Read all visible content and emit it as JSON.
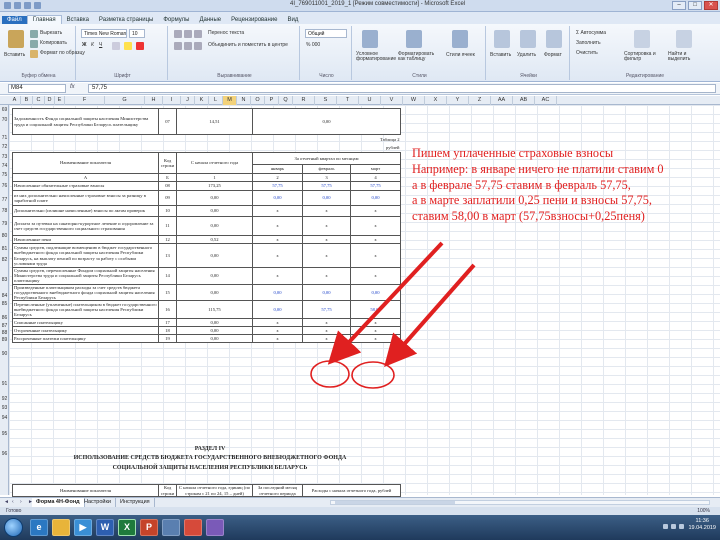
{
  "window": {
    "title": "4I_769011001_2019_1  [Режим совместимости] - Microsoft Excel",
    "minimize": "–",
    "restore": "□",
    "close": "✕"
  },
  "ribbon_tabs": [
    "Файл",
    "Главная",
    "Вставка",
    "Разметка страницы",
    "Формулы",
    "Данные",
    "Рецензирование",
    "Вид"
  ],
  "ribbon": {
    "clipboard": {
      "paste": "Вставить",
      "cut": "Вырезать",
      "copy": "Копировать",
      "format_painter": "Формат по образцу",
      "label": "Буфер обмена"
    },
    "font": {
      "name": "Times New Roman",
      "size": "10",
      "label": "Шрифт"
    },
    "alignment": {
      "wrap": "Перенос текста",
      "merge": "Объединить и поместить в центре",
      "label": "Выравнивание"
    },
    "number": {
      "format": "Общий",
      "label": "Число"
    },
    "styles": {
      "conditional": "Условное форматирование",
      "table": "Форматировать как таблицу",
      "cell_styles": "Стили ячеек",
      "label": "Стили"
    },
    "cells": {
      "insert": "Вставить",
      "delete": "Удалить",
      "format": "Формат",
      "label": "Ячейки"
    },
    "editing": {
      "autosum": "Автосумма",
      "fill": "Заполнить",
      "clear": "Очистить",
      "sort": "Сортировка и фильтр",
      "find": "Найти и выделить",
      "label": "Редактирование"
    }
  },
  "formula_bar": {
    "name_box": "M84",
    "fx": "fx",
    "value": "57,75"
  },
  "columns": [
    "A",
    "B",
    "C",
    "D",
    "E",
    "F",
    "G",
    "H",
    "I",
    "J",
    "K",
    "L",
    "M",
    "N",
    "O",
    "P",
    "Q",
    "R",
    "S",
    "T",
    "U",
    "V",
    "W",
    "X",
    "Y",
    "Z",
    "AA",
    "AB",
    "AC"
  ],
  "rows": [
    "69",
    "70",
    "71",
    "72",
    "73",
    "74",
    "75",
    "76",
    "77",
    "78",
    "79",
    "80",
    "81",
    "82",
    "83",
    "84",
    "85",
    "86",
    "87",
    "88",
    "89",
    "90",
    "91",
    "92",
    "93",
    "94",
    "95",
    "96"
  ],
  "sheet": {
    "row70": {
      "name": "Задолженность Фонда социальной защиты населения Министерства труда и социальной защиты Республики Беларусь плательщику",
      "code": "07",
      "start": "14,51",
      "q": "0,00"
    },
    "table2": "Таблица 2",
    "rubles": "рублей",
    "head": {
      "name": "Наименование показателя",
      "code": "Код строки",
      "start": "С начала отчетного года",
      "quarter": "За отчетный квартал по месяцам",
      "m1": "январь",
      "m2": "февраль",
      "m3": "март"
    },
    "letters": {
      "a": "А",
      "b": "Б",
      "n1": "1",
      "n2": "2",
      "n3": "3",
      "n4": "4"
    },
    "rows": [
      {
        "name": "Начисленные обязательные страховые взносы",
        "code": "08",
        "start": "173,25",
        "m1": "57,75",
        "m2": "57,75",
        "m3": "57,75"
      },
      {
        "name": "из них дополнительно начисленные страховые взносы за разницу в заработной плате",
        "code": "09",
        "start": "0,00",
        "m1": "0,00",
        "m2": "0,00",
        "m3": "0,00"
      },
      {
        "name": "Дополнительно (излишне начисленные) взносы по актам проверок",
        "code": "10",
        "start": "0,00",
        "m1": "x",
        "m2": "x",
        "m3": "x"
      },
      {
        "name": "Доплата за путевки на санаторно-курортное лечение и оздоровление за счет средств государственного социального страхования",
        "code": "11",
        "start": "0,00",
        "m1": "x",
        "m2": "x",
        "m3": "x"
      },
      {
        "name": "Начисленные пени",
        "code": "12",
        "start": "0,52",
        "m1": "x",
        "m2": "x",
        "m3": "x"
      },
      {
        "name": "Суммы средств, подлежащие возмещению в бюджет государственного внебюджетного фонда социальной защиты населения Республики Беларусь, на выплату пенсий по возрасту за работу с особыми условиями труда",
        "code": "13",
        "start": "0,00",
        "m1": "x",
        "m2": "x",
        "m3": "x"
      },
      {
        "name": "Суммы средств, перечисленные Фондом социальной защиты населения Министерства труда и социальной защиты Республики Беларусь плательщику",
        "code": "14",
        "start": "0,00",
        "m1": "x",
        "m2": "x",
        "m3": "x"
      },
      {
        "name": "Произведенные плательщиком расходы за счет средств бюджета государственного внебюджетного фонда социальной защиты населения Республики Беларусь",
        "code": "15",
        "start": "0,00",
        "m1": "0,00",
        "m2": "0,00",
        "m3": "0,00"
      },
      {
        "name": "Перечисленные (уплаченные) плательщиком в бюджет государственного внебюджетного фонда социальной защиты населения Республики Беларусь",
        "code": "16",
        "start": "115,75",
        "m1": "0,00",
        "m2": "57,75",
        "m3": "58,00"
      },
      {
        "name": "Списанные плательщику",
        "code": "17",
        "start": "0,00",
        "m1": "x",
        "m2": "x",
        "m3": "x"
      },
      {
        "name": "Отсроченные плательщику",
        "code": "18",
        "start": "0,00",
        "m1": "x",
        "m2": "x",
        "m3": "x"
      },
      {
        "name": "Рассроченные платежи плательщику",
        "code": "19",
        "start": "0,00",
        "m1": "x",
        "m2": "x",
        "m3": "x"
      }
    ],
    "section": {
      "title1": "РАЗДЕЛ IV",
      "title2": "ИСПОЛЬЗОВАНИЕ СРЕДСТВ БЮДЖЕТА ГОСУДАРСТВЕННОГО ВНЕБЮДЖЕТНОГО ФОНДА",
      "title3": "СОЦИАЛЬНОЙ ЗАЩИТЫ НАСЕЛЕНИЯ РЕСПУБЛИКИ БЕЛАРУСЬ"
    },
    "foot_head": {
      "name": "Наименование показателя",
      "code": "Код строки",
      "c1": "С начала отчетного года, единиц (по строкам с 21 по 24, 15 – дней)",
      "c2": "За последний месяц отчетного периода",
      "c3": "Расходы с начала отчетного года, рублей"
    }
  },
  "annotation": {
    "line1": "Пишем уплаченные страховые взносы",
    "line2": "Например: в январе ничего не платили ставим 0",
    "line3": "а в феврале 57,75 ставим в февраль 57,75,",
    "line4": "а в марте заплатили 0,25 пени и взносы 57,75,",
    "line5": "ставим 58,00 в март (57,75взносы+0,25пеня)"
  },
  "sheet_tabs": [
    "Форма 4Н-Фонд",
    "Настройки",
    "Инструкция"
  ],
  "status": {
    "ready": "Готово",
    "zoom": "100%"
  },
  "taskbar": {
    "time": "11:36",
    "date": "19.04.2019"
  },
  "colors": {
    "annotation": "#e02020",
    "value_blue": "#1a40c8",
    "selection": "#f3d27a"
  }
}
